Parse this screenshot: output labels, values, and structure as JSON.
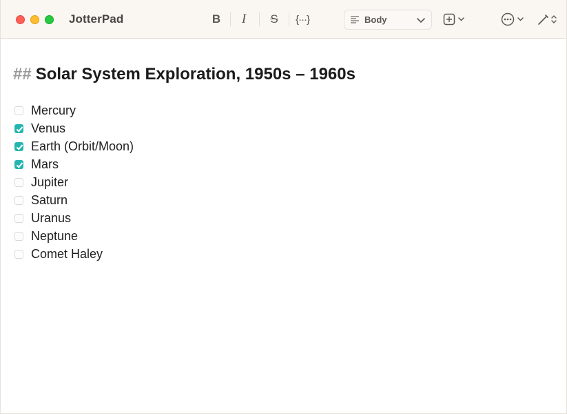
{
  "app": {
    "title": "JotterPad"
  },
  "toolbar": {
    "bold_label": "B",
    "italic_label": "I",
    "strike_label": "S",
    "code_label": "{···}",
    "style_select_value": "Body",
    "icons": {
      "paragraph_style": "text-align-left-icon",
      "insert": "plus-square-icon",
      "more": "ellipsis-circle-icon",
      "pen": "pen-icon",
      "chevron": "chevron-down-icon"
    }
  },
  "document": {
    "heading_marker": "##",
    "heading_text": "Solar System Exploration, 1950s – 1960s",
    "tasks": [
      {
        "label": "Mercury",
        "checked": false
      },
      {
        "label": "Venus",
        "checked": true
      },
      {
        "label": "Earth (Orbit/Moon)",
        "checked": true
      },
      {
        "label": "Mars",
        "checked": true
      },
      {
        "label": "Jupiter",
        "checked": false
      },
      {
        "label": "Saturn",
        "checked": false
      },
      {
        "label": "Uranus",
        "checked": false
      },
      {
        "label": "Neptune",
        "checked": false
      },
      {
        "label": "Comet Haley",
        "checked": false
      }
    ]
  },
  "colors": {
    "checkbox_checked": "#25b5b0",
    "titlebar_bg": "#faf6f2",
    "close": "#fe5f57",
    "minimize": "#febc2e",
    "maximize": "#28c840"
  }
}
